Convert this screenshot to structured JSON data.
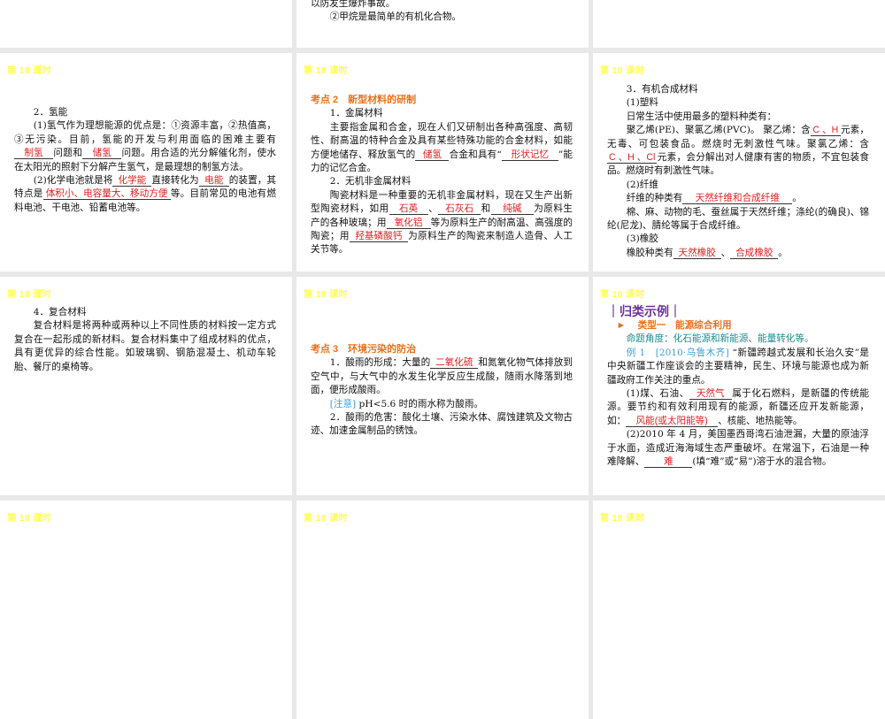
{
  "slide_title": "第 18 课时",
  "slides": [
    {
      "id": "s0",
      "title": "",
      "blocks": []
    },
    {
      "id": "s1",
      "title": "",
      "blocks": [
        {
          "cls": "",
          "segs": [
            {
              "t": "以防发生爆炸事故。"
            }
          ]
        },
        {
          "cls": "ind",
          "segs": [
            {
              "t": "②甲烷是最简单的有机化合物。"
            }
          ]
        }
      ]
    },
    {
      "id": "s2",
      "title": "",
      "blocks": []
    },
    {
      "id": "s3",
      "title": "第 18 课时",
      "blocks": [
        {
          "cls": "ind",
          "segs": [
            {
              "t": "2．氢能"
            }
          ]
        },
        {
          "cls": "ind",
          "segs": [
            {
              "t": "(1)氢气作为理想能源的优点是：①资源丰富，②热值高，③无污染。目前，氢能的开发与利用面临的困难主要有"
            },
            {
              "b": "制氢",
              "w": 40
            },
            {
              "t": "问题和"
            },
            {
              "b": "储氢",
              "w": 40
            },
            {
              "t": "问题。用合适的光分解催化剂，使水在太阳光的照射下分解产生氢气，是最理想的制氢方法。"
            }
          ]
        },
        {
          "cls": "ind",
          "segs": [
            {
              "t": "(2)化学电池就是将"
            },
            {
              "b": "化学能",
              "w": 40
            },
            {
              "t": "直接转化为"
            },
            {
              "b": "电能",
              "w": 30
            },
            {
              "t": "的装置，其特点是"
            },
            {
              "b": "体积小、电容量大、移动方便",
              "w": 140
            },
            {
              "t": "等。目前常见的电池有燃料电池、干电池、铅蓄电池等。"
            }
          ]
        }
      ]
    },
    {
      "id": "s4",
      "title": "第 18 课时",
      "blocks": [
        {
          "cls": "heading",
          "segs": [
            {
              "t": "考点 2　新型材料的研制"
            }
          ]
        },
        {
          "cls": "ind",
          "segs": [
            {
              "t": "1．金属材料"
            }
          ]
        },
        {
          "cls": "ind",
          "segs": [
            {
              "t": "主要指金属和合金，现在人们又研制出各种高强度、高韧性、耐高温的特种合金及具有某些特殊功能的合金材料，如能方便地储存、释放氢气的"
            },
            {
              "b": "储氢",
              "w": 34
            },
            {
              "t": "合金和具有“"
            },
            {
              "b": "形状记忆",
              "w": 60
            },
            {
              "t": "”能力的记忆合金。"
            }
          ]
        },
        {
          "cls": "ind",
          "segs": [
            {
              "t": "2．无机非金属材料"
            }
          ]
        },
        {
          "cls": "ind",
          "segs": [
            {
              "t": "陶瓷材料是一种重要的无机非金属材料，现在又生产出新型陶瓷材料，如用"
            },
            {
              "b": "石英",
              "w": 40
            },
            {
              "t": "、"
            },
            {
              "b": "石灰石",
              "w": 44
            },
            {
              "t": "和"
            },
            {
              "b": "纯碱",
              "w": 44
            },
            {
              "t": "为原料生产的各种玻璃；用"
            },
            {
              "b": "氧化铝",
              "w": 46
            },
            {
              "t": "等为原料生产的耐高温、高强度的陶瓷；用"
            },
            {
              "b": "羟基磷酸钙",
              "w": 62
            },
            {
              "t": "为原料生产的陶瓷来制造人造骨、人工关节等。"
            }
          ]
        }
      ]
    },
    {
      "id": "s5",
      "title": "第 18 课时",
      "blocks": [
        {
          "cls": "ind",
          "segs": [
            {
              "t": "3．有机合成材料"
            }
          ]
        },
        {
          "cls": "ind",
          "segs": [
            {
              "t": "(1)塑料"
            }
          ]
        },
        {
          "cls": "ind",
          "segs": [
            {
              "t": "日常生活中使用最多的塑料种类有："
            }
          ]
        },
        {
          "cls": "ind",
          "segs": [
            {
              "t": "聚乙烯(PE)、聚氯乙烯(PVC)。 聚乙烯：含"
            },
            {
              "b": "C 、H",
              "w": 30
            },
            {
              "t": "元素，无毒、可包装食品。燃烧时无刺激性气味。聚氯乙烯：含"
            },
            {
              "b": "C 、H 、Cl",
              "w": 40
            },
            {
              "t": "元素，会分解出对人健康有害的物质，不宜包装食品。燃烧时有刺激性气味。"
            }
          ]
        },
        {
          "cls": "ind",
          "segs": [
            {
              "t": "(2)纤维"
            }
          ]
        },
        {
          "cls": "ind",
          "segs": [
            {
              "t": "纤维的种类有"
            },
            {
              "b": "天然纤维和合成纤维",
              "w": 120
            },
            {
              "t": "。"
            }
          ]
        },
        {
          "cls": "ind",
          "segs": [
            {
              "t": "棉、麻、动物的毛、蚕丝属于天然纤维；涤纶(的确良)、锦纶(尼龙)、腈纶等属于合成纤维。"
            }
          ]
        },
        {
          "cls": "ind",
          "segs": [
            {
              "t": "(3)橡胶"
            }
          ]
        },
        {
          "cls": "ind",
          "segs": [
            {
              "t": "橡胶种类有"
            },
            {
              "b": "天然橡胶",
              "w": 50
            },
            {
              "t": "、"
            },
            {
              "b": "合成橡胶",
              "w": 50
            },
            {
              "t": "。"
            }
          ]
        }
      ]
    },
    {
      "id": "s6",
      "title": "第 18 课时",
      "blocks": [
        {
          "cls": "ind",
          "segs": [
            {
              "t": "4．复合材料"
            }
          ]
        },
        {
          "cls": "ind",
          "segs": [
            {
              "t": "复合材料是将两种或两种以上不同性质的材料按一定方式复合在一起形成的新材料。复合材料集中了组成材料的优点，具有更优异的综合性能。如玻璃钢、钢筋混凝土、机动车轮胎、餐厅的桌椅等。"
            }
          ]
        }
      ]
    },
    {
      "id": "s7",
      "title": "第 18 课时",
      "blocks": [
        {
          "cls": "heading",
          "segs": [
            {
              "t": "考点 3　环境污染的防治"
            }
          ]
        },
        {
          "cls": "ind",
          "segs": [
            {
              "t": "1．酸雨的形成：大量的"
            },
            {
              "b": "二氧化硫",
              "w": 50
            },
            {
              "t": "和氮氧化物气体排放到空气中，与大气中的水发生化学反应生成酸，随雨水降落到地面，便形成酸雨。"
            }
          ]
        },
        {
          "cls": "ind",
          "segs": [
            {
              "t": "[注意]",
              "c": "blue"
            },
            {
              "t": " pH<5.6 时的雨水称为酸雨。"
            }
          ]
        },
        {
          "cls": "ind",
          "segs": [
            {
              "t": "2．酸雨的危害：酸化土壤、污染水体、腐蚀建筑及文物古迹、加速金属制品的锈蚀。"
            }
          ]
        }
      ]
    },
    {
      "id": "s8",
      "title": "第 18 课时",
      "blocks": [
        {
          "cls": "purplebox",
          "segs": [
            {
              "t": "｜归类示例｜"
            }
          ]
        },
        {
          "cls": "",
          "segs": [
            {
              "t": "　► 　类型一　能源综合利用",
              "c": "orange"
            }
          ]
        },
        {
          "cls": "ind",
          "segs": [
            {
              "t": "命题角度：化石能源和新能源、能量转化等。",
              "c": "teal"
            }
          ]
        },
        {
          "cls": "ind",
          "segs": [
            {
              "t": "例 1　[2010·乌鲁木齐]",
              "c": "blue"
            },
            {
              "t": " “新疆跨越式发展和长治久安”是中央新疆工作座谈会的主要精神，民生、环境与能源也成为新疆政府工作关注的重点。"
            }
          ]
        },
        {
          "cls": "ind",
          "segs": [
            {
              "t": "(1)煤、石油、"
            },
            {
              "b": "天然气",
              "w": 44
            },
            {
              "t": "属于化石燃料，是新疆的传统能源。要节约和有效利用现有的能源，新疆还应开发新能源，如："
            },
            {
              "b": "风能(或太阳能等)",
              "w": 100
            },
            {
              "t": "、核能、地热能等。"
            }
          ]
        },
        {
          "cls": "ind",
          "segs": [
            {
              "t": "(2)2010 年 4 月，美国墨西哥湾石油泄漏，大量的原油浮于水面，造成近海海域生态严重破坏。在常温下，石油是一种难降解、"
            },
            {
              "b": "难",
              "w": 50
            },
            {
              "t": "(填“难”或“易”)溶于水的混合物。"
            }
          ]
        }
      ]
    },
    {
      "id": "s9",
      "title": "第 18 课时",
      "blocks": []
    },
    {
      "id": "s10",
      "title": "第 18 课时",
      "blocks": []
    },
    {
      "id": "s11",
      "title": "第 18 课时",
      "blocks": []
    }
  ]
}
